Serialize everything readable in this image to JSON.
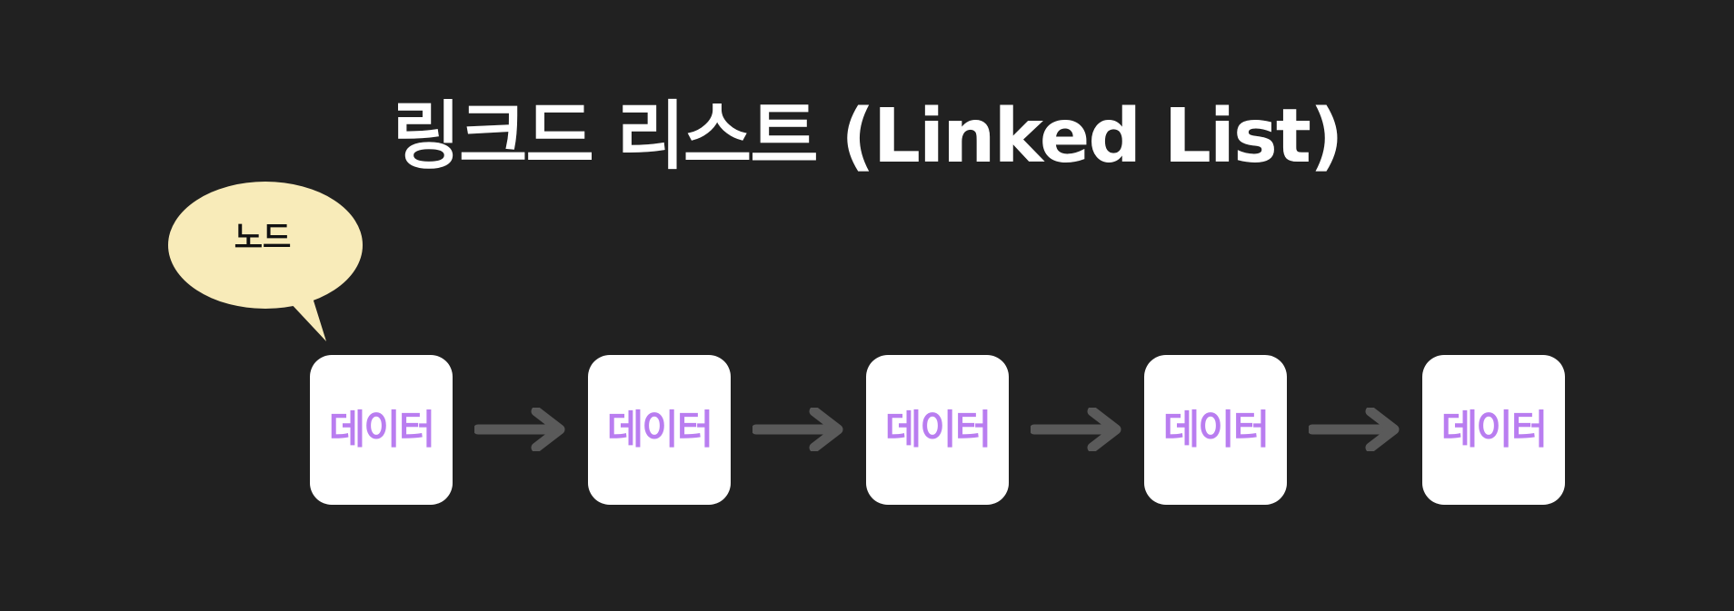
{
  "diagram": {
    "title": "링크드 리스트 (Linked List)",
    "callout": {
      "label": "노드",
      "fill_color": "#f8ebb9"
    },
    "nodes": [
      {
        "label": "데이터"
      },
      {
        "label": "데이터"
      },
      {
        "label": "데이터"
      },
      {
        "label": "데이터"
      },
      {
        "label": "데이터"
      }
    ],
    "arrow_count": 4,
    "colors": {
      "background": "#212121",
      "title": "#ffffff",
      "node_fill": "#ffffff",
      "node_text": "#b97df0",
      "arrow": "#5a5a5a",
      "callout_text": "#111111"
    }
  }
}
